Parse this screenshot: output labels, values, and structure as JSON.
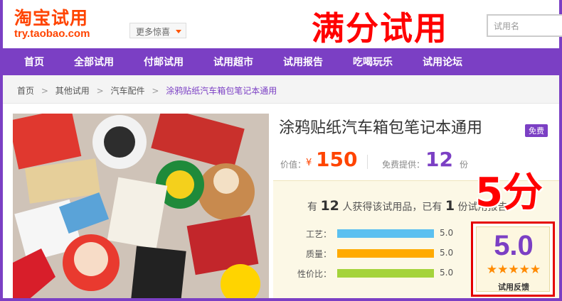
{
  "header": {
    "logo_cn": "淘宝试用",
    "logo_en": "try.taobao.com",
    "more_label": "更多惊喜",
    "banner_title": "满分试用",
    "search_placeholder": "试用名"
  },
  "nav": {
    "items": [
      "首页",
      "全部试用",
      "付邮试用",
      "试用超市",
      "试用报告",
      "吃喝玩乐",
      "试用论坛"
    ]
  },
  "breadcrumb": {
    "items": [
      "首页",
      "其他试用",
      "汽车配件",
      "涂鸦贴纸汽车箱包笔记本通用"
    ],
    "separator": ">"
  },
  "product": {
    "title": "涂鸦贴纸汽车箱包笔记本通用",
    "free_tag": "免费",
    "price_label": "价值：",
    "price_symbol": "¥",
    "price": "150",
    "supply_label": "免费提供：",
    "supply_count": "12",
    "supply_unit": "份"
  },
  "reviews": {
    "summary_prefix": "有",
    "applicants": "12",
    "summary_mid": "人获得该试用品，已有",
    "reports": "1",
    "summary_suffix": "份试用报告",
    "ratings": [
      {
        "label": "工艺：",
        "value": "5.0",
        "fraction": 1.0,
        "color": "#5bc0f0"
      },
      {
        "label": "质量：",
        "value": "5.0",
        "fraction": 1.0,
        "color": "#ffaa00"
      },
      {
        "label": "性价比：",
        "value": "5.0",
        "fraction": 1.0,
        "color": "#a4d33b"
      }
    ],
    "overall_score": "5.0",
    "stars": "★★★★★",
    "star_count": 5,
    "feedback_label": "试用反馈",
    "big_score": "5分"
  },
  "colors": {
    "brand_purple": "#7b3fc4",
    "taobao_orange": "#ff4400",
    "highlight_red": "#ff0000"
  }
}
